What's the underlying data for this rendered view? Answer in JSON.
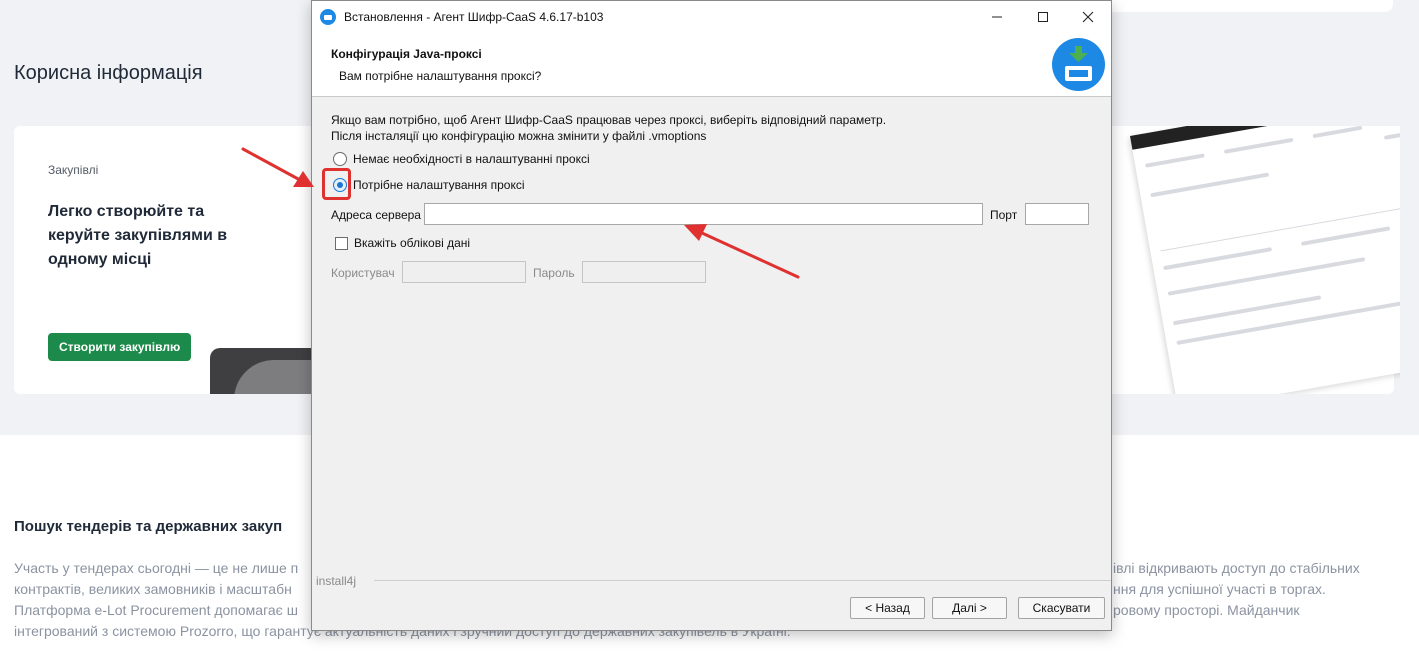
{
  "page": {
    "section_title": "Корисна інформація",
    "card": {
      "category": "Закупівлі",
      "heading": "Легко створюйте та керуйте закупівлями в одному місці",
      "button": "Створити закупівлю"
    },
    "search_title": "Пошук тендерів та державних закуп",
    "paragraph_left": [
      "Участь у тендерах сьогодні — це не лише п",
      "контрактів, великих замовників і масштабн",
      "Платформа e-Lot Procurement допомагає ш",
      "інтегрований з системою Prozorro, що гарантує актуальність даних і зручний доступ до державних закупівель в Україні."
    ],
    "paragraph_right": [
      "івлі відкривають доступ до стабільних",
      "ння для успішної участі в торгах.",
      "ровому просторі. Майданчик"
    ]
  },
  "dialog": {
    "window_title": "Встановлення - Агент Шифр-CaaS 4.6.17-b103",
    "header_title": "Конфігурація Java-проксі",
    "header_subtitle": "Вам потрібне налаштування проксі?",
    "intro_line1": "Якщо вам потрібно, щоб Агент Шифр-CaaS працював через проксі, виберіть відповідний параметр.",
    "intro_line2": "Після інсталяції цю конфігурацію можна змінити у файлі .vmoptions",
    "option_no_proxy": "Немає необхідності в налаштуванні проксі",
    "option_proxy": "Потрібне налаштування проксі",
    "selected_option": "proxy",
    "server_label": "Адреса сервера",
    "server_value": "",
    "port_label": "Порт",
    "port_value": "",
    "credentials_label": "Вкажіть облікові дані",
    "credentials_checked": false,
    "user_label": "Користувач",
    "user_value": "",
    "password_label": "Пароль",
    "password_value": "",
    "footer_brand": "install4j",
    "back_button": "< Назад",
    "next_button": "Далі >",
    "cancel_button": "Скасувати"
  },
  "icons": {
    "minimize": "minimize-icon",
    "maximize": "maximize-icon",
    "close": "close-icon",
    "app": "installer-app-icon",
    "header_logo": "download-tray-icon"
  },
  "colors": {
    "accent_blue": "#1e88e5",
    "annotation_red": "#e03131",
    "primary_green": "#1c8a4a"
  }
}
